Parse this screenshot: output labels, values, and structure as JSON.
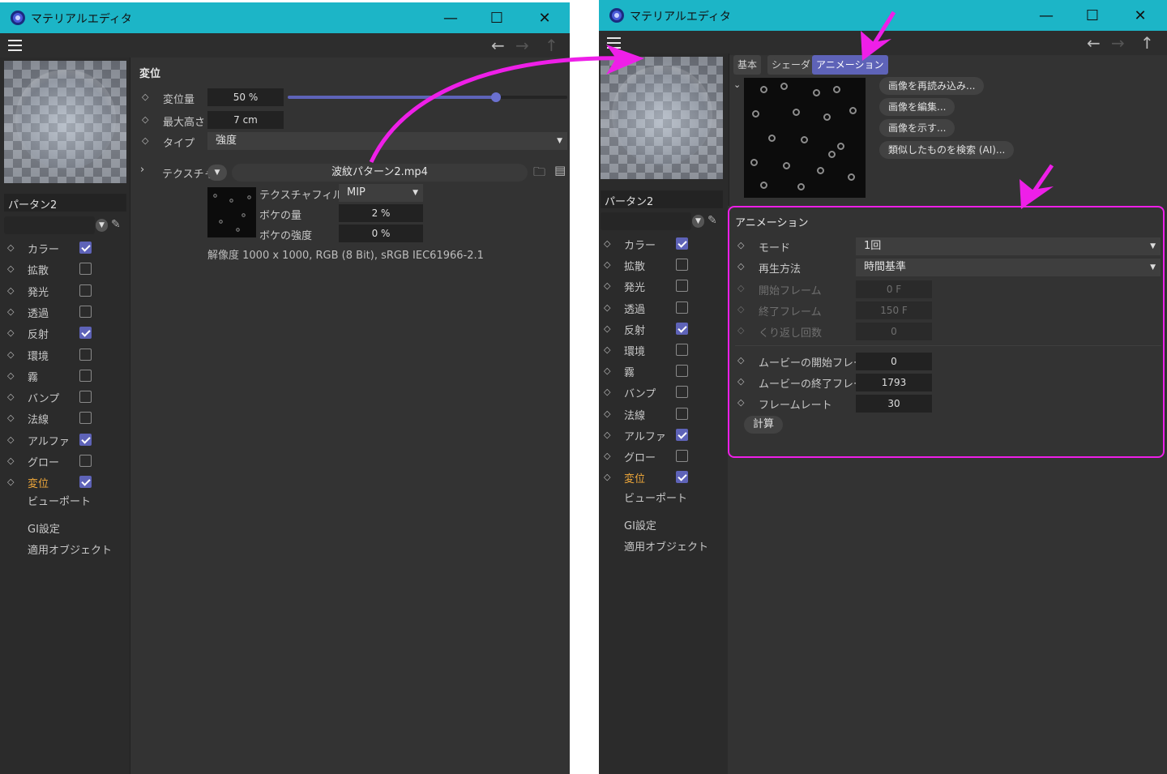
{
  "accent_color": "#5e63b8",
  "titlebar_color": "#1cb5c7",
  "annotation_color": "#ee1fe8",
  "left_window": {
    "title": "マテリアルエディタ",
    "material_name": "パータン2",
    "channels": [
      {
        "label": "カラー",
        "checked": true
      },
      {
        "label": "拡散",
        "checked": false
      },
      {
        "label": "発光",
        "checked": false
      },
      {
        "label": "透過",
        "checked": false
      },
      {
        "label": "反射",
        "checked": true
      },
      {
        "label": "環境",
        "checked": false
      },
      {
        "label": "霧",
        "checked": false
      },
      {
        "label": "バンプ",
        "checked": false
      },
      {
        "label": "法線",
        "checked": false
      },
      {
        "label": "アルファ",
        "checked": true
      },
      {
        "label": "グロー",
        "checked": false
      },
      {
        "label": "変位",
        "checked": true
      }
    ],
    "extra_items": [
      "ビューポート",
      "GI設定",
      "適用オブジェクト"
    ],
    "section_title": "変位",
    "displacement": {
      "amount_label": "変位量",
      "amount_value": "50 %",
      "amount_fraction": 0.5,
      "height_label": "最大高さ",
      "height_value": "7 cm",
      "type_label": "タイプ",
      "type_value": "強度",
      "texture_label": "テクスチャ",
      "texture_file": "波紋パターン2.mp4",
      "filter_label": "テクスチャフィルタ",
      "filter_value": "MIP",
      "bokeh_label": "ボケの量",
      "bokeh_value": "2 %",
      "bokeh_strength_label": "ボケの強度",
      "bokeh_strength_value": "0 %",
      "resolution_text": "解像度 1000 x 1000, RGB (8 Bit), sRGB IEC61966-2.1"
    }
  },
  "right_window": {
    "title": "マテリアルエディタ",
    "material_name": "パータン2",
    "tabs": [
      "基本",
      "シェーダ",
      "アニメーション"
    ],
    "active_tab": "アニメーション",
    "image_buttons": [
      "画像を再読み込み...",
      "画像を編集...",
      "画像を示す...",
      "類似したものを検索 (AI)..."
    ],
    "channels": [
      {
        "label": "カラー",
        "checked": true
      },
      {
        "label": "拡散",
        "checked": false
      },
      {
        "label": "発光",
        "checked": false
      },
      {
        "label": "透過",
        "checked": false
      },
      {
        "label": "反射",
        "checked": true
      },
      {
        "label": "環境",
        "checked": false
      },
      {
        "label": "霧",
        "checked": false
      },
      {
        "label": "バンプ",
        "checked": false
      },
      {
        "label": "法線",
        "checked": false
      },
      {
        "label": "アルファ",
        "checked": true
      },
      {
        "label": "グロー",
        "checked": false
      },
      {
        "label": "変位",
        "checked": true
      }
    ],
    "extra_items": [
      "ビューポート",
      "GI設定",
      "適用オブジェクト"
    ],
    "animation": {
      "section_title": "アニメーション",
      "mode_label": "モード",
      "mode_value": "1回",
      "playback_label": "再生方法",
      "playback_value": "時間基準",
      "start_frame_label": "開始フレーム",
      "start_frame_value": "0 F",
      "end_frame_label": "終了フレーム",
      "end_frame_value": "150 F",
      "loops_label": "くり返し回数",
      "loops_value": "0",
      "movie_start_label": "ムービーの開始フレーム",
      "movie_start_value": "0",
      "movie_end_label": "ムービーの終了フレーム",
      "movie_end_value": "1793",
      "framerate_label": "フレームレート",
      "framerate_value": "30",
      "calc_label": "計算"
    }
  }
}
